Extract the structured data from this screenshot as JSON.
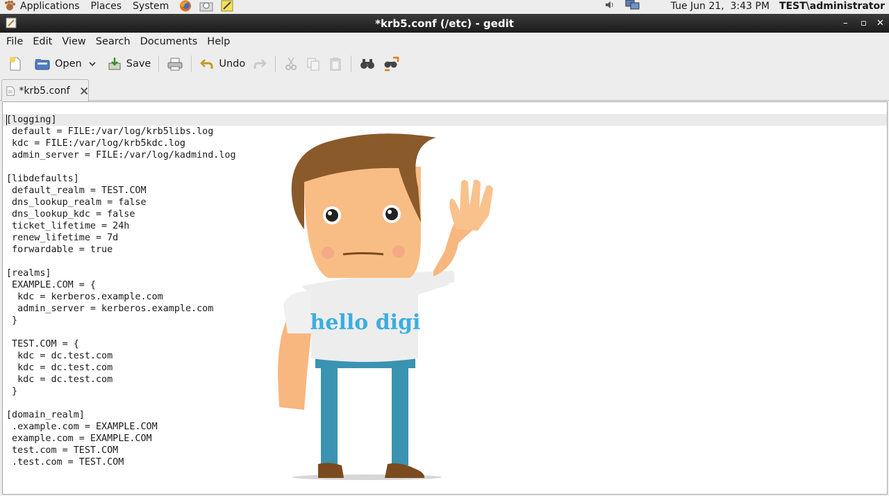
{
  "panel": {
    "applications": "Applications",
    "places": "Places",
    "system": "System",
    "launchers": [
      "firefox-icon",
      "mail-icon",
      "notes-icon"
    ],
    "datetime": "Tue Jun 21,  3:43 PM",
    "user": "TEST\\administrator"
  },
  "window": {
    "title": "*krb5.conf (/etc) - gedit",
    "minimize": "–",
    "maximize": "▫",
    "close": "✕"
  },
  "menubar": [
    "File",
    "Edit",
    "View",
    "Search",
    "Documents",
    "Help"
  ],
  "toolbar": {
    "open_label": "Open",
    "save_label": "Save",
    "undo_label": "Undo"
  },
  "tab": {
    "label": "*krb5.conf"
  },
  "editor": {
    "lines": [
      "[logging]",
      " default = FILE:/var/log/krb5libs.log",
      " kdc = FILE:/var/log/krb5kdc.log",
      " admin_server = FILE:/var/log/kadmind.log",
      "",
      "[libdefaults]",
      " default_realm = TEST.COM",
      " dns_lookup_realm = false",
      " dns_lookup_kdc = false",
      " ticket_lifetime = 24h",
      " renew_lifetime = 7d",
      " forwardable = true",
      "",
      "[realms]",
      " EXAMPLE.COM = {",
      "  kdc = kerberos.example.com",
      "  admin_server = kerberos.example.com",
      " }",
      "",
      " TEST.COM = {",
      "  kdc = dc.test.com",
      "  kdc = dc.test.com",
      "  kdc = dc.test.com",
      " }",
      "",
      "[domain_realm]",
      " .example.com = EXAMPLE.COM",
      " example.com = EXAMPLE.COM",
      " test.com = TEST.COM",
      " .test.com = TEST.COM"
    ]
  },
  "overlay": {
    "shirt_text": "hello digi"
  }
}
